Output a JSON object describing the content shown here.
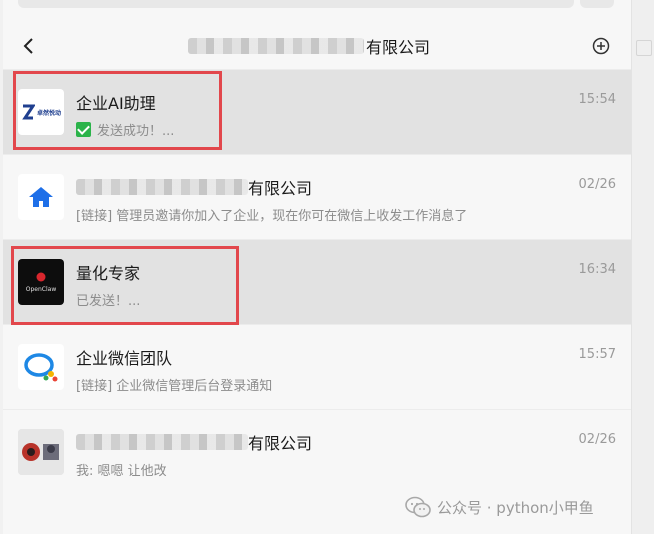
{
  "header": {
    "title_suffix": "有限公司"
  },
  "conversations": [
    {
      "name": "企业AI助理",
      "time": "15:54",
      "preview": "发送成功！...",
      "preview_status": "sent-check",
      "avatar_icon": "zhuoran-logo",
      "avatar_text": "卓然悦动"
    },
    {
      "name_suffix": "有限公司",
      "time": "02/26",
      "preview": "[链接] 管理员邀请你加入了企业，现在你可在微信上收发工作消息了",
      "avatar_icon": "home-icon"
    },
    {
      "name": "量化专家",
      "time": "16:34",
      "preview": "已发送！...",
      "avatar_icon": "openclaw-logo",
      "avatar_text": "OpenClaw"
    },
    {
      "name": "企业微信团队",
      "time": "15:57",
      "preview": "[链接] 企业微信管理后台登录通知",
      "avatar_icon": "wecom-logo"
    },
    {
      "name_suffix": "有限公司",
      "time": "02/26",
      "preview": "我: 嗯嗯   让他改",
      "avatar_icon": "group-avatar"
    }
  ],
  "watermark": {
    "text": "公众号 · python小甲鱼",
    "icon": "wechat-icon"
  },
  "colors": {
    "selected_row": "#e2e2e2",
    "highlight_box": "#e2474c",
    "check_green": "#2bb34a",
    "wecom_blue": "#1e88e5"
  }
}
